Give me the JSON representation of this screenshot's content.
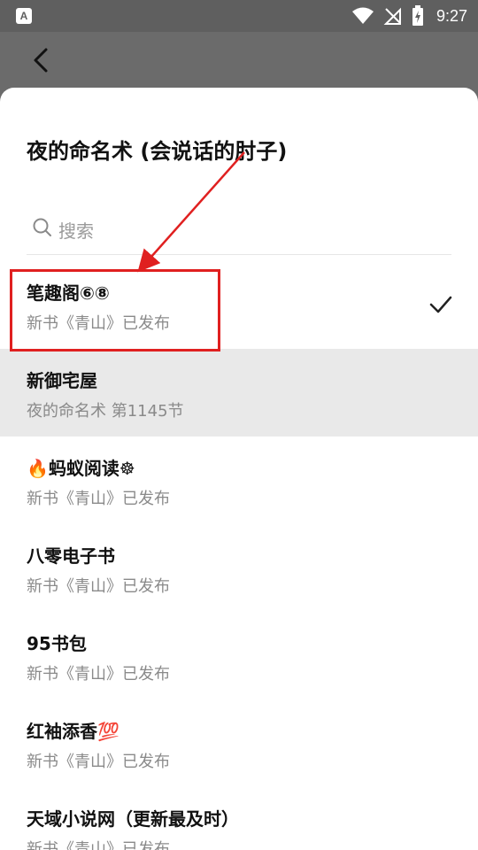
{
  "status_bar": {
    "left_icon_letter": "A",
    "time": "9:27"
  },
  "sheet": {
    "title": "夜的命名术 (会说话的肘子)",
    "search_placeholder": "搜索"
  },
  "sources": [
    {
      "name": "笔趣阁⑥⑧",
      "sub": "新书《青山》已发布",
      "selected": true
    },
    {
      "name": "新御宅屋",
      "sub": "夜的命名术 第1145节",
      "highlighted": true
    },
    {
      "name": "🔥蚂蚁阅读☸",
      "sub": "新书《青山》已发布"
    },
    {
      "name": "八零电子书",
      "sub": "新书《青山》已发布"
    },
    {
      "name": "95书包",
      "sub": "新书《青山》已发布"
    },
    {
      "name": "红袖添香💯",
      "sub": "新书《青山》已发布"
    },
    {
      "name": "天域小说网（更新最及时）",
      "sub": "新书《青山》已发布"
    }
  ],
  "colors": {
    "annotation": "#e02020",
    "highlight_row": "#e9e9e9"
  }
}
